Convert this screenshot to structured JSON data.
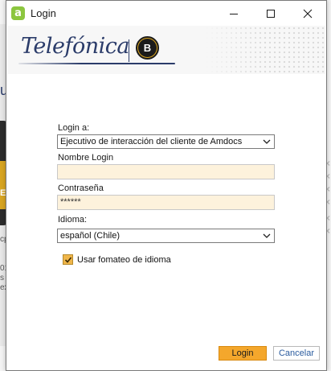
{
  "window": {
    "title": "Login",
    "app_icon_letter": "a",
    "controls": {
      "minimize": "minimize-icon",
      "maximize": "maximize-icon",
      "close": "close-icon"
    }
  },
  "banner": {
    "brand_name": "Telefónica",
    "logo_letter": "B"
  },
  "form": {
    "login_a_label": "Login a:",
    "login_a_value": "Ejecutivo de interacción del cliente de Amdocs",
    "username_label": "Nombre Login",
    "username_required": "*",
    "username_value": "",
    "password_label": "Contraseña",
    "password_required": "*",
    "password_value": "******",
    "language_label": "Idioma:",
    "language_value": "español (Chile)",
    "use_locale_format_label": "Usar fomateo de idioma",
    "use_locale_format_checked": true
  },
  "buttons": {
    "login": "Login",
    "cancel": "Cancelar"
  },
  "colors": {
    "accent_orange": "#f4a72c",
    "input_fill": "#fdf2dc",
    "brand_navy": "#2b3c6a",
    "app_icon_green": "#8cc63f"
  },
  "background": {
    "left_fragments": [
      "u",
      "E",
      "cp",
      "01",
      "s",
      "ex"
    ]
  }
}
